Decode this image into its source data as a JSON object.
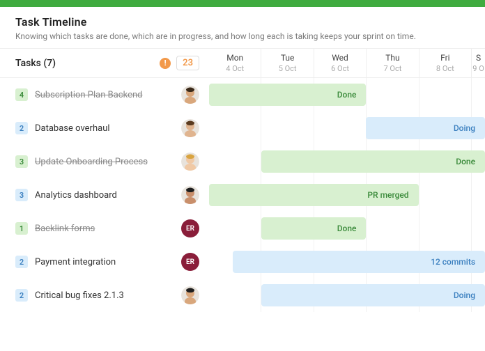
{
  "header": {
    "title": "Task Timeline",
    "subtitle": "Knowing which tasks are done, which are in progress, and how long each is taking keeps your sprint on time."
  },
  "columns_header": {
    "label": "Tasks (7)",
    "warn": "!",
    "count": "23"
  },
  "days": [
    {
      "name": "Mon",
      "date": "4 Oct"
    },
    {
      "name": "Tue",
      "date": "5 Oct"
    },
    {
      "name": "Wed",
      "date": "6 Oct"
    },
    {
      "name": "Thu",
      "date": "7 Oct"
    },
    {
      "name": "Fri",
      "date": "8 Oct"
    },
    {
      "name": "S",
      "date": "9 O"
    }
  ],
  "tasks": [
    {
      "badge": "4",
      "badge_color": "g",
      "name": "Subscription Plan Backend",
      "done": true,
      "avatar_type": "face1",
      "bar": {
        "start": 0,
        "end": 3,
        "color": "green",
        "label": "Done"
      }
    },
    {
      "badge": "2",
      "badge_color": "b",
      "name": "Database overhaul",
      "done": false,
      "avatar_type": "face2",
      "bar": {
        "start": 3,
        "end": 5.27,
        "color": "blue",
        "label": "Doing"
      }
    },
    {
      "badge": "3",
      "badge_color": "g",
      "name": "Update Onboarding Process",
      "done": true,
      "avatar_type": "face3",
      "bar": {
        "start": 1,
        "end": 5.27,
        "color": "green",
        "label": "Done"
      }
    },
    {
      "badge": "3",
      "badge_color": "b",
      "name": "Analytics dashboard",
      "done": false,
      "avatar_type": "face4",
      "bar": {
        "start": 0,
        "end": 4,
        "color": "green",
        "label": "PR merged"
      }
    },
    {
      "badge": "1",
      "badge_color": "g",
      "name": "Backlink forms",
      "done": true,
      "avatar_type": "initials",
      "avatar_text": "ER",
      "avatar_bg": "#8a1e3a",
      "bar": {
        "start": 1,
        "end": 3,
        "color": "green",
        "label": "Done"
      }
    },
    {
      "badge": "2",
      "badge_color": "b",
      "name": "Payment integration",
      "done": false,
      "avatar_type": "initials",
      "avatar_text": "ER",
      "avatar_bg": "#8a1e3a",
      "bar": {
        "start": 0.45,
        "end": 5.27,
        "color": "blue",
        "label": "12 commits"
      }
    },
    {
      "badge": "2",
      "badge_color": "b",
      "name": "Critical bug fixes 2.1.3",
      "done": false,
      "avatar_type": "face5",
      "bar": {
        "start": 1,
        "end": 5.27,
        "color": "blue",
        "label": "Doing"
      }
    }
  ],
  "timeline": {
    "total_units": 5.27
  }
}
